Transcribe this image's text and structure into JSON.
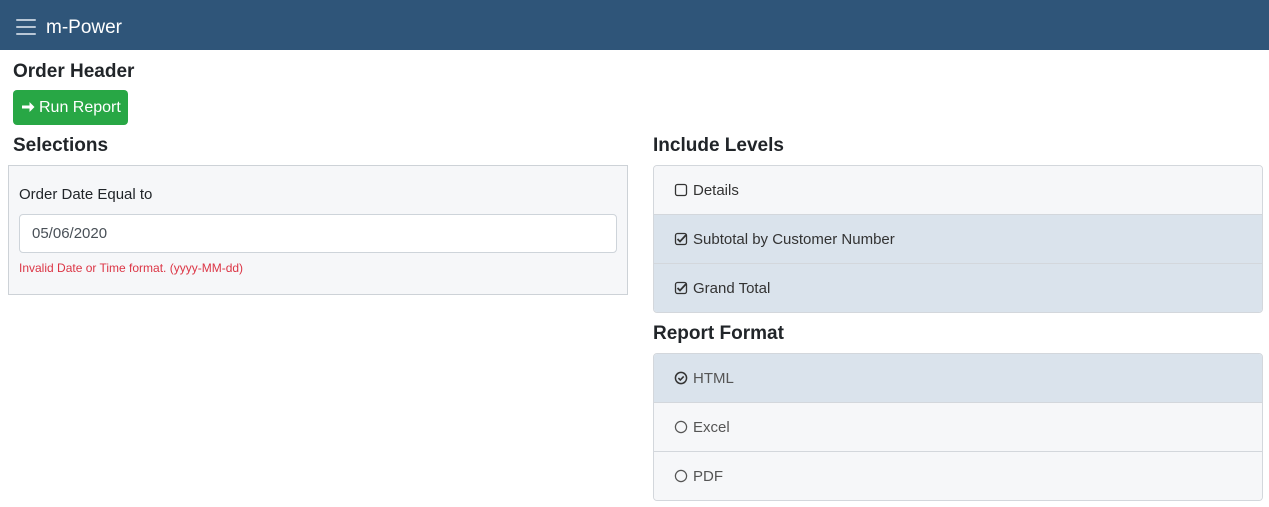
{
  "navbar": {
    "brand": "m-Power",
    "menu_icon": "hamburger-menu-icon",
    "bg_color": "#2f5579"
  },
  "page": {
    "title": "Order Header"
  },
  "run_button": {
    "label": "Run Report",
    "icon": "arrow-right-icon",
    "color": "#28a745"
  },
  "selections": {
    "title": "Selections",
    "field_label": "Order Date Equal to",
    "date_value": "05/06/2020",
    "error": "Invalid Date or Time format. (yyyy-MM-dd)"
  },
  "include_levels": {
    "title": "Include Levels",
    "items": [
      {
        "label": "Details",
        "checked": false,
        "icon": "unchecked-box-icon"
      },
      {
        "label": "Subtotal by Customer Number",
        "checked": true,
        "icon": "checked-box-icon"
      },
      {
        "label": "Grand Total",
        "checked": true,
        "icon": "checked-box-icon"
      }
    ]
  },
  "report_format": {
    "title": "Report Format",
    "items": [
      {
        "label": "HTML",
        "selected": true,
        "icon": "radio-checked-icon"
      },
      {
        "label": "Excel",
        "selected": false,
        "icon": "radio-empty-icon"
      },
      {
        "label": "PDF",
        "selected": false,
        "icon": "radio-empty-icon"
      }
    ]
  },
  "colors": {
    "accent_active": "#dae3ec",
    "error": "#dc3545"
  }
}
